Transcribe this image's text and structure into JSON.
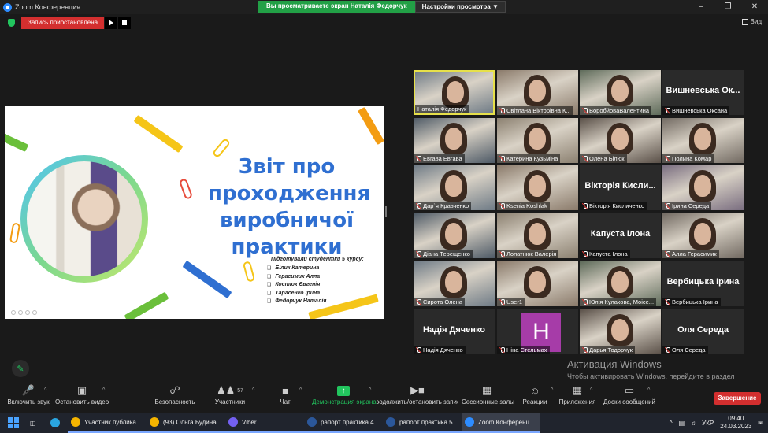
{
  "window": {
    "title": "Zoom Конференция",
    "share_banner": "Вы просматриваете экран Наталія Федорчук",
    "view_options": "Настройки просмотра",
    "controls": [
      "–",
      "❐",
      "✕"
    ]
  },
  "recording": {
    "status": "Запись приостановлена",
    "view_label": "Вид"
  },
  "slide": {
    "title_lines": [
      "Звіт про",
      "проходження",
      "виробничої",
      "практики"
    ],
    "subtitle": "Підготували студентки 5 курсу:",
    "students": [
      "Білик Катерина",
      "Герасимик Алла",
      "Костюк Євгенія",
      "Тарасенко Ірина",
      "Федорчук Наталія"
    ]
  },
  "participants": [
    {
      "name": "Наталія Федорчук",
      "muted": false,
      "video": true,
      "active": true
    },
    {
      "name": "Світлана Вікторівна К...",
      "muted": true,
      "video": true
    },
    {
      "name": "ВоробйоваВалентина",
      "muted": true,
      "video": true
    },
    {
      "name": "Вишневська Оксана",
      "muted": true,
      "video": false,
      "big_name": "Вишневська Ок..."
    },
    {
      "name": "Евгава Евгава",
      "muted": true,
      "video": true
    },
    {
      "name": "Катерина Кузьміна",
      "muted": true,
      "video": true
    },
    {
      "name": "Олена Білюк",
      "muted": true,
      "video": true
    },
    {
      "name": "Полина Комар",
      "muted": true,
      "video": true
    },
    {
      "name": "Дар`я Кравченко",
      "muted": true,
      "video": true
    },
    {
      "name": "Ksenia Koshlak",
      "muted": true,
      "video": true
    },
    {
      "name": "Вікторія Кисличенко",
      "muted": true,
      "video": false,
      "big_name": "Вікторія Кисли..."
    },
    {
      "name": "Ірина Середа",
      "muted": true,
      "video": true
    },
    {
      "name": "Діана Терещенко",
      "muted": true,
      "video": true
    },
    {
      "name": "Лопатнюк Валерія",
      "muted": true,
      "video": true
    },
    {
      "name": "Капуста Ілона",
      "muted": true,
      "video": false,
      "big_name": "Капуста Ілона"
    },
    {
      "name": "Алла Герасимик",
      "muted": true,
      "video": true
    },
    {
      "name": "Сирота Олена",
      "muted": true,
      "video": true
    },
    {
      "name": "User1",
      "muted": true,
      "video": true
    },
    {
      "name": "Юлія Кулакова, Моісе...",
      "muted": true,
      "video": true
    },
    {
      "name": "Вербицька Ірина",
      "muted": true,
      "video": false,
      "big_name": "Вербицька Ірина"
    },
    {
      "name": "Надія Дяченко",
      "muted": true,
      "video": false,
      "big_name": "Надія Дяченко"
    },
    {
      "name": "Ніна Стельмах",
      "muted": true,
      "video": false,
      "avatar_letter": "H"
    },
    {
      "name": "Дарья Тодорчук",
      "muted": true,
      "video": true
    },
    {
      "name": "Оля Середа",
      "muted": true,
      "video": false,
      "big_name": "Оля Середа"
    }
  ],
  "activation": {
    "title": "Активация Windows",
    "text": "Чтобы активировать Windows, перейдите в раздел \"Параметры\"."
  },
  "toolbar": {
    "unmute": "Включить звук",
    "stop_video": "Остановить видео",
    "security": "Безопасность",
    "participants": "Участники",
    "participants_count": "57",
    "chat": "Чат",
    "share_screen": "Демонстрация экрана",
    "record": "Продолжить/остановить запись",
    "breakout": "Сессионные залы",
    "reactions": "Реакции",
    "apps": "Приложения",
    "whiteboards": "Доски сообщений",
    "end": "Завершение"
  },
  "taskbar": {
    "apps": [
      {
        "label": "Участник публика...",
        "color": "#f4b400"
      },
      {
        "label": "(93) Ольга Будина...",
        "color": "#f4b400"
      },
      {
        "label": "Viber",
        "color": "#7360f2"
      },
      {
        "label": "рапорт практика 4...",
        "color": "#2b579a"
      },
      {
        "label": "рапорт практика 5...",
        "color": "#2b579a"
      },
      {
        "label": "Zoom Конференц...",
        "color": "#2d8cff"
      }
    ],
    "language": "УКР",
    "time": "09:40",
    "date": "24.03.2023"
  },
  "colors": {
    "share_green": "#22a046",
    "record_red": "#d32f2f",
    "active_speaker": "#e6e04a",
    "slide_title_blue": "#2f6fd1"
  }
}
